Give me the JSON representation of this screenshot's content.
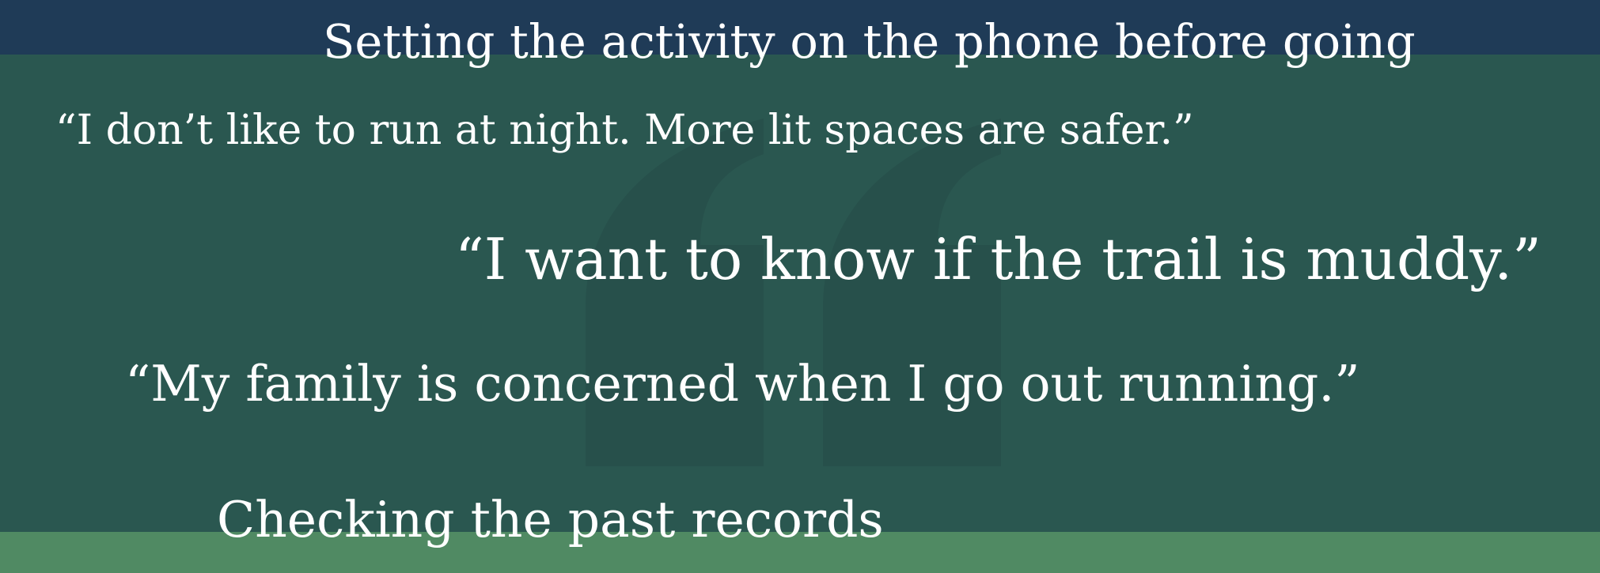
{
  "slide": {
    "colors": {
      "background": "#2a5750",
      "top_band": "#1f3b57",
      "bottom_band": "#508a63",
      "text": "#ffffff",
      "quote_mark": "#27504b"
    },
    "decorative_icon": "quote-mark-icon",
    "lines": [
      "Setting the activity on the phone before going",
      "“I don’t like to run at night. More lit spaces are safer.”",
      "“I want to know if the trail is muddy.”",
      "“My family is concerned when I go out running.”",
      "Checking the past records"
    ]
  }
}
